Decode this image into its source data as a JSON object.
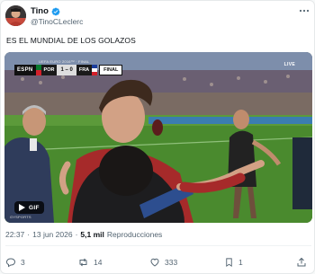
{
  "post": {
    "author_name": "Tino",
    "author_handle": "@TinoCLeclerc",
    "verified": true,
    "text": "ES EL MUNDIAL DE LOS GOLAZOS",
    "time": "22:37",
    "date": "13 jun 2026",
    "separator": "·",
    "views_count": "5,1 mil",
    "views_label": "Reproducciones"
  },
  "media": {
    "type": "GIF",
    "badge_label": "GIF",
    "scorebug": {
      "network": "ESPN",
      "competition": "UEFA EURO 2016™ · FINAL",
      "home": "POR",
      "score": "1 – 0",
      "away": "FRA",
      "status": "FINAL"
    },
    "live_label": "LIVE",
    "watermark": "GYSPORTS"
  },
  "actions": {
    "replies": "3",
    "reposts": "14",
    "likes": "333",
    "bookmarks": "1"
  },
  "colors": {
    "text_primary": "#0f1419",
    "text_secondary": "#536471",
    "verified_blue": "#1d9bf0",
    "divider": "#eff3f4"
  },
  "icons": [
    "more-icon",
    "verified-icon",
    "play-icon",
    "reply-icon",
    "repost-icon",
    "like-icon",
    "bookmark-icon",
    "share-icon"
  ]
}
